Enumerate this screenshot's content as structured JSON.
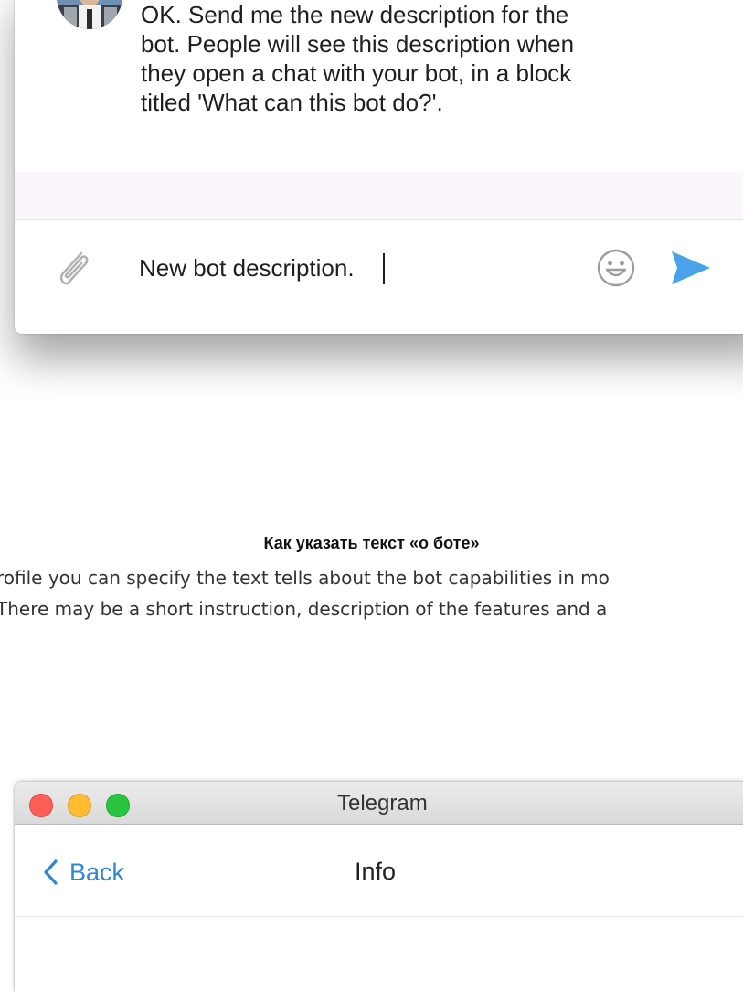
{
  "chat": {
    "bot_message": "OK. Send me the new description for the bot. People will see this description when they open a chat with your bot, in a block titled 'What can this bot do?'.",
    "composer": {
      "value": "New bot description."
    }
  },
  "article": {
    "heading": "Как указать текст «о боте»",
    "line1": "rofile you can specify the text tells about the bot capabilities in mo",
    "line2": "There may be a short instruction, description of the features and a"
  },
  "telegram_window": {
    "title": "Telegram",
    "back_label": "Back",
    "nav_title": "Info"
  },
  "colors": {
    "accent": "#2e86d6",
    "send": "#4aa3e8",
    "close": "#fd5f57",
    "minimize": "#febc2e",
    "maximize": "#29c440"
  },
  "icons": [
    "avatar",
    "paperclip-icon",
    "emoji-icon",
    "send-icon",
    "chevron-left-icon"
  ]
}
